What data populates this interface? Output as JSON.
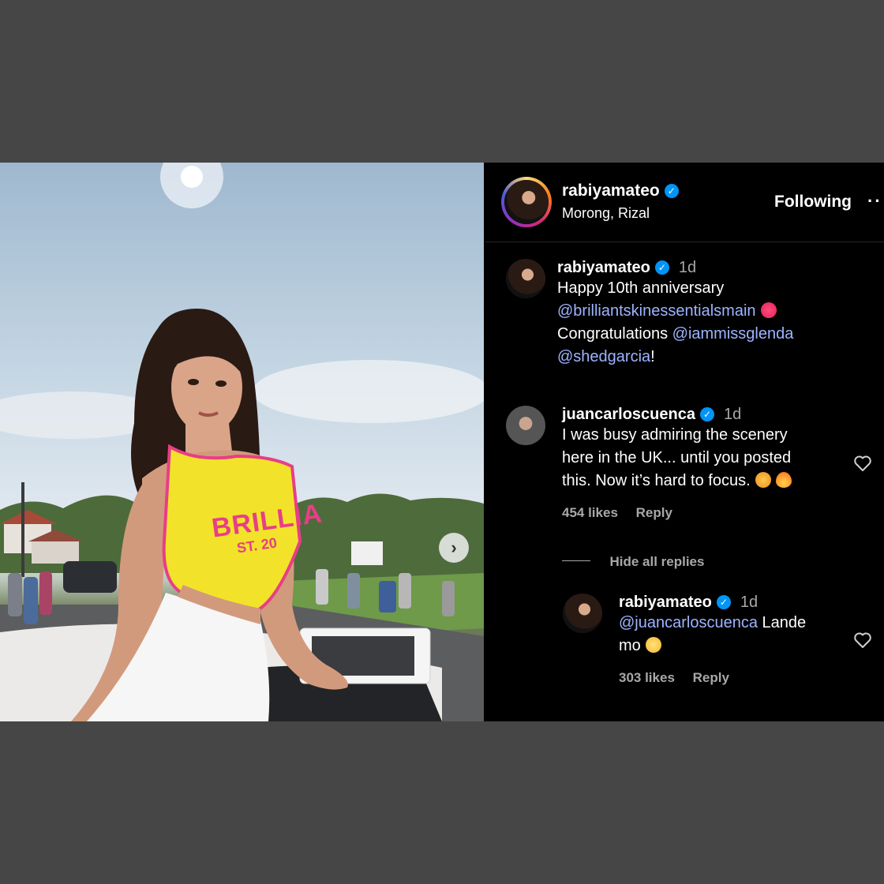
{
  "post": {
    "author": "rabiyamateo",
    "location": "Morong, Rizal",
    "follow_label": "Following",
    "more_label": "··",
    "next_label": "›"
  },
  "caption": {
    "user": "rabiyamateo",
    "time": "1d",
    "line1": "Happy 10th anniversary",
    "mention1": "@brilliantskinessentialsmain",
    "line2": "Congratulations",
    "mention2": "@iammissglenda",
    "mention3": "@shedgarcia",
    "end": "!"
  },
  "comment": {
    "user": "juancarloscuenca",
    "time": "1d",
    "text_line1": "I was busy admiring the scenery",
    "text_line2": "here in the UK... until you posted",
    "text_line3": "this. Now it’s hard to focus.",
    "likes": "454 likes",
    "reply_label": "Reply",
    "hide_replies": "Hide all replies"
  },
  "reply": {
    "user": "rabiyamateo",
    "time": "1d",
    "mention": "@juancarloscuenca",
    "text_line1": "Lande",
    "text_line2": "mo",
    "likes": "303 likes",
    "reply_label": "Reply"
  },
  "photo": {
    "shirt_text": "BRILLIA",
    "shirt_sub": "ST. 20"
  },
  "colors": {
    "background": "#464646",
    "panel": "#000000",
    "mention": "#9db4ff",
    "verified": "#0095f6",
    "shirt": "#f2e32a",
    "shirt_print": "#e83e86"
  }
}
